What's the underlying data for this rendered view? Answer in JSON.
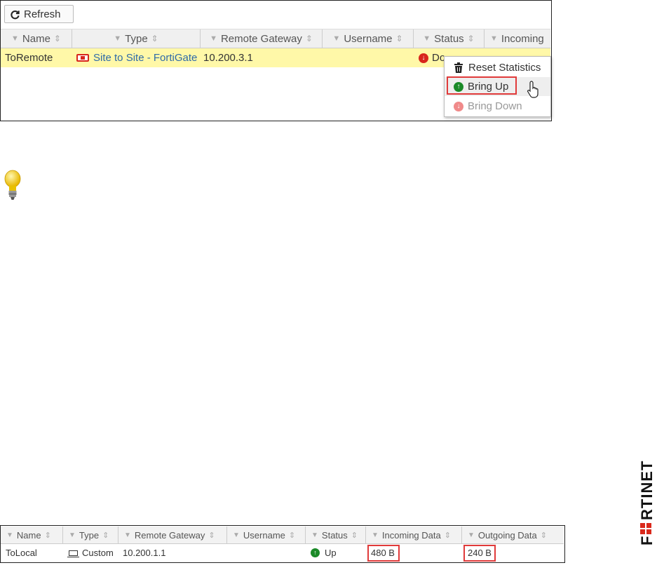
{
  "top_table": {
    "refresh_label": "Refresh",
    "columns": [
      "Name",
      "Type",
      "Remote Gateway",
      "Username",
      "Status",
      "Incoming"
    ],
    "row": {
      "name": "ToRemote",
      "type": "Site to Site - FortiGate",
      "remote_gateway": "10.200.3.1",
      "username": "",
      "status": "Do"
    }
  },
  "context_menu": {
    "items": [
      "Reset Statistics",
      "Bring Up",
      "Bring Down"
    ]
  },
  "bottom_table": {
    "columns": [
      "Name",
      "Type",
      "Remote Gateway",
      "Username",
      "Status",
      "Incoming Data",
      "Outgoing Data"
    ],
    "row": {
      "name": "ToLocal",
      "type": "Custom",
      "remote_gateway": "10.200.1.1",
      "username": "",
      "status": "Up",
      "incoming_data": "480 B",
      "outgoing_data": "240 B"
    }
  },
  "colors": {
    "highlight_row": "#fff8a8",
    "annotation_red": "#e03a3a",
    "status_down": "#d8261c",
    "status_up": "#1b8a28",
    "logo_red": "#da291c"
  },
  "icons": [
    "refresh-icon",
    "filter-icon",
    "sort-icon",
    "fortigate-icon",
    "status-down-icon",
    "trash-icon",
    "bring-up-icon",
    "bring-down-icon",
    "hand-cursor-icon",
    "lightbulb-icon",
    "laptop-icon",
    "status-up-icon"
  ],
  "logo": "FORTINET"
}
